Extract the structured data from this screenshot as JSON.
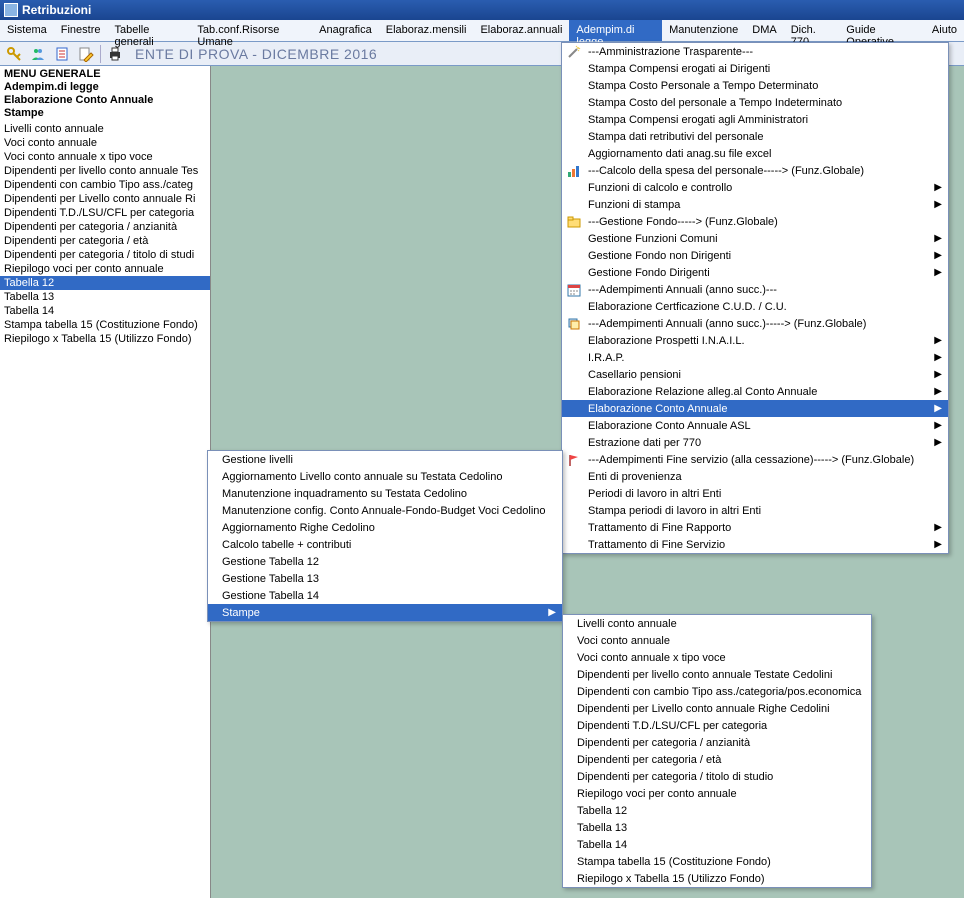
{
  "window": {
    "title": "Retribuzioni"
  },
  "menubar": {
    "items": [
      "Sistema",
      "Finestre",
      "Tabelle generali",
      "Tab.conf.Risorse Umane",
      "Anagrafica",
      "Elaboraz.mensili",
      "Elaboraz.annuali",
      "Adempim.di legge",
      "Manutenzione",
      "DMA",
      "Dich. 770",
      "Guide Operative",
      "Aiuto"
    ],
    "active_index": 7
  },
  "breadcrumb": "ENTE DI PROVA - DICEMBRE 2016",
  "sidebar": {
    "header": [
      "MENU GENERALE",
      "Adempim.di legge",
      " Elaborazione Conto Annuale",
      "Stampe"
    ],
    "items": [
      "Livelli conto annuale",
      "Voci conto annuale",
      "Voci conto annuale x tipo voce",
      "Dipendenti per livello conto annuale Tes",
      "Dipendenti con cambio Tipo ass./categ",
      "Dipendenti per Livello conto annuale Ri",
      "Dipendenti T.D./LSU/CFL per categoria",
      "Dipendenti per categoria / anzianità",
      "Dipendenti per categoria / età",
      "Dipendenti per categoria / titolo di studi",
      "Riepilogo voci per conto annuale",
      "Tabella 12",
      "Tabella 13",
      "Tabella 14",
      "Stampa tabella 15 (Costituzione Fondo)",
      "Riepilogo x Tabella 15 (Utilizzo Fondo)"
    ],
    "selected_index": 11
  },
  "menu1": {
    "groups": [
      {
        "icon": "wand",
        "head": "---Amministrazione Trasparente---",
        "items": [
          {
            "t": "Stampa Compensi erogati ai Dirigenti"
          },
          {
            "t": "Stampa Costo Personale a Tempo Determinato"
          },
          {
            "t": "Stampa Costo del personale a Tempo Indeterminato"
          },
          {
            "t": "Stampa Compensi erogati agli Amministratori"
          },
          {
            "t": "Stampa dati retributivi del personale"
          },
          {
            "t": "Aggiornamento dati anag.su file excel"
          }
        ]
      },
      {
        "icon": "chart",
        "head": "---Calcolo della spesa del personale-----> (Funz.Globale)",
        "items": [
          {
            "t": "Funzioni di calcolo e controllo",
            "sub": true
          },
          {
            "t": "Funzioni di stampa",
            "sub": true
          }
        ]
      },
      {
        "icon": "folder",
        "head": "---Gestione Fondo-----> (Funz.Globale)",
        "items": [
          {
            "t": "Gestione Funzioni Comuni",
            "sub": true
          },
          {
            "t": "Gestione Fondo non Dirigenti",
            "sub": true
          },
          {
            "t": "Gestione Fondo Dirigenti",
            "sub": true
          }
        ]
      },
      {
        "icon": "calendar",
        "head": "---Adempimenti Annuali (anno succ.)---",
        "items": [
          {
            "t": "Elaborazione Certficazione C.U.D. / C.U."
          }
        ]
      },
      {
        "icon": "stack",
        "head": "---Adempimenti Annuali (anno succ.)-----> (Funz.Globale)",
        "items": [
          {
            "t": "Elaborazione Prospetti I.N.A.I.L.",
            "sub": true
          },
          {
            "t": "I.R.A.P.",
            "sub": true
          },
          {
            "t": "Casellario pensioni",
            "sub": true
          },
          {
            "t": "Elaborazione Relazione alleg.al Conto Annuale",
            "sub": true
          },
          {
            "t": "Elaborazione Conto Annuale",
            "sub": true,
            "selected": true
          },
          {
            "t": "Elaborazione Conto Annuale ASL",
            "sub": true
          },
          {
            "t": "Estrazione dati per 770",
            "sub": true
          }
        ]
      },
      {
        "icon": "flag",
        "head": "---Adempimenti Fine servizio (alla cessazione)-----> (Funz.Globale)",
        "items": [
          {
            "t": "Enti di provenienza"
          },
          {
            "t": "Periodi di lavoro in altri Enti"
          },
          {
            "t": "Stampa periodi di lavoro in altri Enti"
          },
          {
            "t": "Trattamento di Fine Rapporto",
            "sub": true
          },
          {
            "t": "Trattamento di Fine Servizio",
            "sub": true
          }
        ]
      }
    ]
  },
  "menu2": {
    "items": [
      {
        "t": "Gestione livelli"
      },
      {
        "t": "Aggiornamento Livello conto annuale su Testata Cedolino"
      },
      {
        "t": "Manutenzione inquadramento su Testata Cedolino"
      },
      {
        "t": "Manutenzione config. Conto Annuale-Fondo-Budget Voci Cedolino"
      },
      {
        "t": "Aggiornamento Righe Cedolino"
      },
      {
        "t": "Calcolo tabelle + contributi"
      },
      {
        "t": "Gestione Tabella 12"
      },
      {
        "t": "Gestione Tabella 13"
      },
      {
        "t": "Gestione Tabella 14"
      },
      {
        "t": "Stampe",
        "sub": true,
        "selected": true
      }
    ]
  },
  "menu3": {
    "items": [
      {
        "t": "Livelli conto annuale"
      },
      {
        "t": "Voci conto annuale"
      },
      {
        "t": "Voci conto annuale x tipo voce"
      },
      {
        "t": "Dipendenti per livello conto annuale Testate Cedolini"
      },
      {
        "t": "Dipendenti con cambio Tipo ass./categoria/pos.economica"
      },
      {
        "t": "Dipendenti per Livello conto annuale Righe Cedolini"
      },
      {
        "t": "Dipendenti T.D./LSU/CFL per categoria"
      },
      {
        "t": "Dipendenti per categoria / anzianità"
      },
      {
        "t": "Dipendenti per categoria / età"
      },
      {
        "t": "Dipendenti per categoria / titolo di studio"
      },
      {
        "t": "Riepilogo voci per conto annuale"
      },
      {
        "t": "Tabella 12"
      },
      {
        "t": "Tabella 13"
      },
      {
        "t": "Tabella 14"
      },
      {
        "t": "Stampa tabella 15 (Costituzione Fondo)"
      },
      {
        "t": "Riepilogo x Tabella 15 (Utilizzo Fondo)"
      }
    ]
  }
}
